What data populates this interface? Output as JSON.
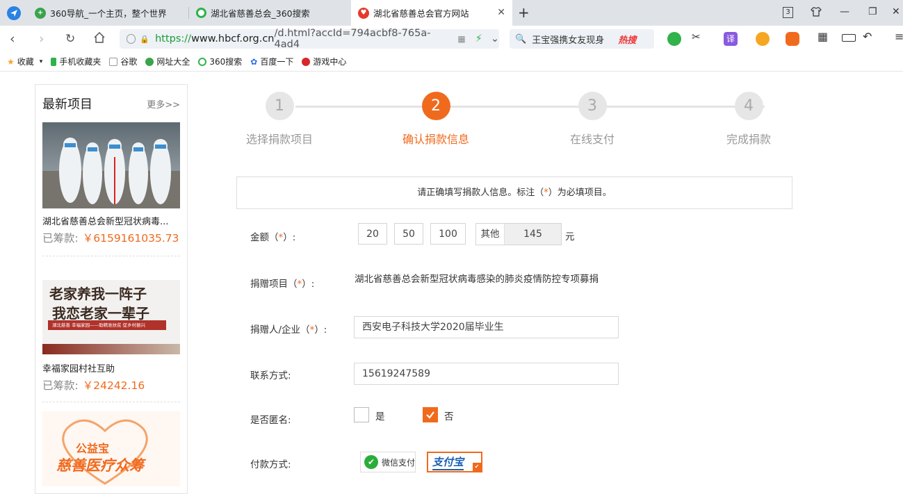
{
  "browser": {
    "tabs": [
      {
        "title": "360导航_一个主页，整个世界"
      },
      {
        "title": "湖北省慈善总会_360搜索"
      },
      {
        "title": "湖北省慈善总会官方网站"
      }
    ],
    "tab_count_badge": "3",
    "url_scheme": "https://",
    "url_host": "www.hbcf.org.cn",
    "url_path": "/d.html?accId=794acbf8-765a-4ad4",
    "search_text": "王宝强携女友现身",
    "search_hot": "热搜",
    "bookmarks": [
      "收藏",
      "手机收藏夹",
      "谷歌",
      "网址大全",
      "360搜索",
      "百度一下",
      "游戏中心"
    ]
  },
  "sidebar": {
    "title": "最新项目",
    "more": "更多>>",
    "items": [
      {
        "name": "湖北省慈善总会新型冠状病毒...",
        "raised_label": "已筹款:",
        "raised_amount": "￥6159161035.73"
      },
      {
        "name": "幸福家园村社互助",
        "raised_label": "已筹款:",
        "raised_amount": "￥24242.16",
        "banner_line1": "老家养我一阵子",
        "banner_line2": "我恋老家一辈子",
        "banner_sub": "湖北慈善 幸福家园——助精准扶贫 促乡村振兴"
      },
      {
        "logo_line1": "公益宝",
        "logo_line2": "慈善医疗众筹"
      }
    ]
  },
  "steps": [
    {
      "num": "1",
      "label": "选择捐款项目"
    },
    {
      "num": "2",
      "label": "确认捐款信息"
    },
    {
      "num": "3",
      "label": "在线支付"
    },
    {
      "num": "4",
      "label": "完成捐款"
    }
  ],
  "notice": {
    "before": "请正确填写捐款人信息。标注（",
    "star": "*",
    "after": "）为必填项目。"
  },
  "form": {
    "amount_label": "金额（",
    "amount_label_end": "）:",
    "amounts": [
      "20",
      "50",
      "100"
    ],
    "other_label": "其他",
    "other_value": "145",
    "unit": "元",
    "project_label": "捐赠项目（",
    "project_value": "湖北省慈善总会新型冠状病毒感染的肺炎疫情防控专项募捐",
    "donor_label": "捐赠人/企业（",
    "donor_value": "西安电子科技大学2020届毕业生",
    "contact_label": "联系方式:",
    "contact_value": "15619247589",
    "anon_label": "是否匿名:",
    "anon_yes": "是",
    "anon_no": "否",
    "pay_label": "付款方式:",
    "pay_wechat": "微信支付",
    "pay_alipay": "支付宝"
  },
  "colors": {
    "accent": "#f06a1d"
  }
}
